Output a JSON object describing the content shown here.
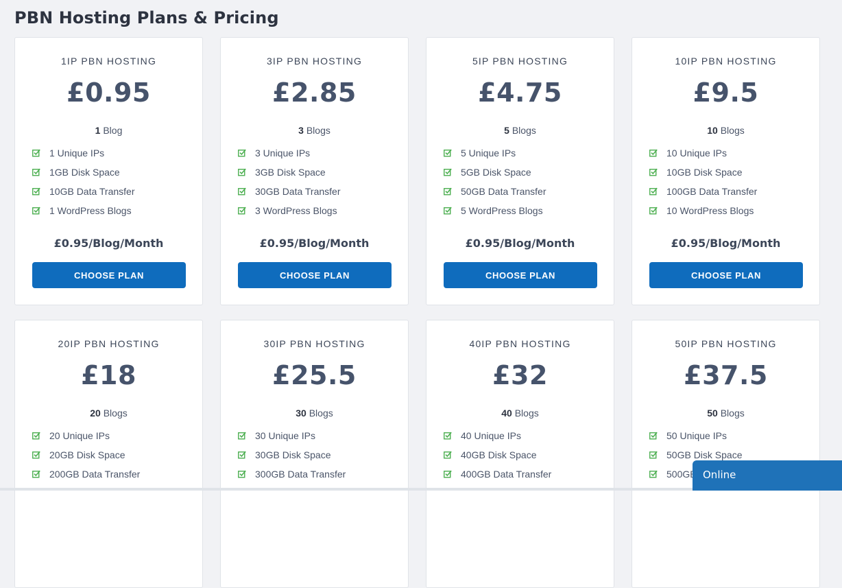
{
  "page": {
    "title": "PBN Hosting Plans & Pricing",
    "check_icon_color": "#4caf50",
    "button_color": "#0f6cbd"
  },
  "plans": [
    {
      "name": "1IP PBN HOSTING",
      "price": "£0.95",
      "blog_count": "1",
      "blog_word": "Blog",
      "features": [
        "1 Unique IPs",
        "1GB Disk Space",
        "10GB Data Transfer",
        "1 WordPress Blogs"
      ],
      "per_blog": "£0.95/Blog/Month",
      "button": "CHOOSE PLAN"
    },
    {
      "name": "3IP PBN HOSTING",
      "price": "£2.85",
      "blog_count": "3",
      "blog_word": "Blogs",
      "features": [
        "3 Unique IPs",
        "3GB Disk Space",
        "30GB Data Transfer",
        "3 WordPress Blogs"
      ],
      "per_blog": "£0.95/Blog/Month",
      "button": "CHOOSE PLAN"
    },
    {
      "name": "5IP PBN HOSTING",
      "price": "£4.75",
      "blog_count": "5",
      "blog_word": "Blogs",
      "features": [
        "5 Unique IPs",
        "5GB Disk Space",
        "50GB Data Transfer",
        "5 WordPress Blogs"
      ],
      "per_blog": "£0.95/Blog/Month",
      "button": "CHOOSE PLAN"
    },
    {
      "name": "10IP PBN HOSTING",
      "price": "£9.5",
      "blog_count": "10",
      "blog_word": "Blogs",
      "features": [
        "10 Unique IPs",
        "10GB Disk Space",
        "100GB Data Transfer",
        "10 WordPress Blogs"
      ],
      "per_blog": "£0.95/Blog/Month",
      "button": "CHOOSE PLAN"
    },
    {
      "name": "20IP PBN HOSTING",
      "price": "£18",
      "blog_count": "20",
      "blog_word": "Blogs",
      "features": [
        "20 Unique IPs",
        "20GB Disk Space",
        "200GB Data Transfer"
      ],
      "per_blog": "",
      "button": ""
    },
    {
      "name": "30IP PBN HOSTING",
      "price": "£25.5",
      "blog_count": "30",
      "blog_word": "Blogs",
      "features": [
        "30 Unique IPs",
        "30GB Disk Space",
        "300GB Data Transfer"
      ],
      "per_blog": "",
      "button": ""
    },
    {
      "name": "40IP PBN HOSTING",
      "price": "£32",
      "blog_count": "40",
      "blog_word": "Blogs",
      "features": [
        "40 Unique IPs",
        "40GB Disk Space",
        "400GB Data Transfer"
      ],
      "per_blog": "",
      "button": ""
    },
    {
      "name": "50IP PBN HOSTING",
      "price": "£37.5",
      "blog_count": "50",
      "blog_word": "Blogs",
      "features": [
        "50 Unique IPs",
        "50GB Disk Space",
        "500GB Data Transfer"
      ],
      "per_blog": "",
      "button": ""
    }
  ],
  "chat": {
    "status": "Online",
    "color": "#1f72b8"
  }
}
